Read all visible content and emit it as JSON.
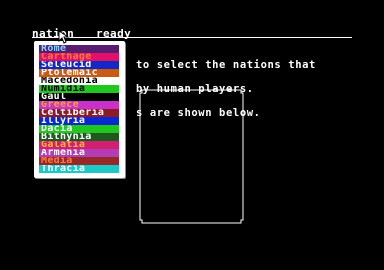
{
  "menubar": {
    "items": [
      "nation",
      "ready"
    ]
  },
  "nation_list": [
    {
      "name": "Rome",
      "bg": "#5a1c6e",
      "fg": "#7fd4ff"
    },
    {
      "name": "Carthage",
      "bg": "#e2106a",
      "fg": "#ff7a3c"
    },
    {
      "name": "Seleucid",
      "bg": "#1428c8",
      "fg": "#ffffff"
    },
    {
      "name": "Ptolemaic",
      "bg": "#c85a14",
      "fg": "#ffffff"
    },
    {
      "name": "Macedonia",
      "bg": "#ffffff",
      "fg": "#000000"
    },
    {
      "name": "Numidia",
      "bg": "#1ec81e",
      "fg": "#000000"
    },
    {
      "name": "Gaul",
      "bg": "#000000",
      "fg": "#ffffff"
    },
    {
      "name": "Greece",
      "bg": "#c832c8",
      "fg": "#ff9d3c"
    },
    {
      "name": "Celtiberia",
      "bg": "#8c1a28",
      "fg": "#ffffff"
    },
    {
      "name": "Illyria",
      "bg": "#0a28d2",
      "fg": "#ffffff"
    },
    {
      "name": "Dacia",
      "bg": "#1ec81e",
      "fg": "#ffffff"
    },
    {
      "name": "Bithynia",
      "bg": "#1e5a1e",
      "fg": "#ffffff"
    },
    {
      "name": "Galatia",
      "bg": "#d22070",
      "fg": "#ffb43c"
    },
    {
      "name": "Armenia",
      "bg": "#b43cb4",
      "fg": "#ffffff"
    },
    {
      "name": "Media",
      "bg": "#962828",
      "fg": "#ff7a3c"
    },
    {
      "name": "Thracia",
      "bg": "#1ec8c8",
      "fg": "#ffffff"
    }
  ],
  "message": {
    "lines": [
      "to select the nations that",
      "by human players.",
      "s are shown below."
    ]
  },
  "colors": {
    "background": "#000000",
    "text": "#ffffff",
    "panel": "#ffffff",
    "frame": "#ffffff"
  }
}
